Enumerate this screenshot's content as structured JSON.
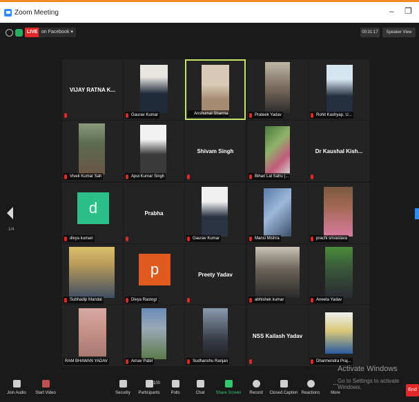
{
  "window": {
    "title": "Zoom Meeting",
    "minimize": "–",
    "restore": "❐"
  },
  "topbar": {
    "live_label": "LIVE",
    "stream_label": "on Facebook ▾",
    "timer": "00:31:17",
    "view_label": "Speaker View"
  },
  "pagination": {
    "page": "1/4"
  },
  "participants": [
    {
      "name": "",
      "big_name": "VIJAY RATNA K..."
    },
    {
      "name": "Gaurav Kumar",
      "big_name": ""
    },
    {
      "name": "Anshumal Sharma",
      "big_name": ""
    },
    {
      "name": "Prateek Yadav",
      "big_name": ""
    },
    {
      "name": "Rohit Kashyap, U...",
      "big_name": ""
    },
    {
      "name": "Vivek Kumar Sah",
      "big_name": ""
    },
    {
      "name": "Apul Kumar Singh",
      "big_name": ""
    },
    {
      "name": "",
      "big_name": "Shivam Singh"
    },
    {
      "name": "Bihari Lal Sahu (...",
      "big_name": ""
    },
    {
      "name": "",
      "big_name": "Dr Kaushal Kish..."
    },
    {
      "name": "divya kumari",
      "big_name": "",
      "letter": "d"
    },
    {
      "name": "",
      "big_name": "Prabha"
    },
    {
      "name": "Gaurav Kumar",
      "big_name": ""
    },
    {
      "name": "Mansi Mishra",
      "big_name": ""
    },
    {
      "name": "prachi srivastava",
      "big_name": ""
    },
    {
      "name": "Subhadip Mandal",
      "big_name": ""
    },
    {
      "name": "Divya Rastogi",
      "big_name": "",
      "letter": "p"
    },
    {
      "name": "",
      "big_name": "Preety Yadav"
    },
    {
      "name": "abhishek kumar",
      "big_name": ""
    },
    {
      "name": "Aneeta Yadav",
      "big_name": ""
    },
    {
      "name": "RAM BHAWAN YADAV",
      "big_name": ""
    },
    {
      "name": "Arnav Patel",
      "big_name": ""
    },
    {
      "name": "Sudhanshu Ranjan",
      "big_name": ""
    },
    {
      "name": "",
      "big_name": "NSS Kailash Yadav"
    },
    {
      "name": "Dharmendra Praj...",
      "big_name": ""
    }
  ],
  "bottombar": {
    "join_audio": "Join Audio",
    "start_video": "Start Video",
    "security": "Security",
    "participants": "Participants",
    "participants_count": "100",
    "polls": "Polls",
    "chat": "Chat",
    "share_screen": "Share Screen",
    "record": "Record",
    "closed_caption": "Closed Caption",
    "reactions": "Reactions",
    "more": "More",
    "end": "End"
  },
  "watermark": {
    "line1": "Activate Windows",
    "line2": "Go to Settings to activate Windows."
  },
  "colors": {
    "accent": "#2d8cff",
    "live": "#e02828",
    "active_border": "#c8e46a",
    "share": "#2ecc71",
    "titlebar_line": "#f08a24"
  }
}
